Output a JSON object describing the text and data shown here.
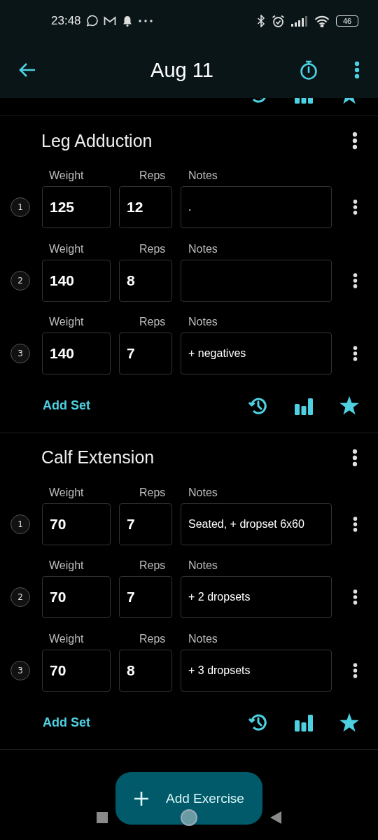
{
  "status_bar": {
    "time": "23:48",
    "battery": "46"
  },
  "header": {
    "title": "Aug 11"
  },
  "exercises": [
    {
      "name": "Leg Adduction",
      "add_set": "Add Set",
      "sets": [
        {
          "number": "1",
          "weight_label": "Weight",
          "reps_label": "Reps",
          "notes_label": "Notes",
          "weight": "125",
          "reps": "12",
          "notes": "."
        },
        {
          "number": "2",
          "weight_label": "Weight",
          "reps_label": "Reps",
          "notes_label": "Notes",
          "weight": "140",
          "reps": "8"
        },
        {
          "number": "3",
          "weight_label": "Weight",
          "reps_label": "Reps",
          "notes_label": "Notes",
          "weight": "140",
          "reps": "7",
          "notes": "+ negatives"
        }
      ]
    },
    {
      "name": "Calf Extension",
      "add_set": "Add Set",
      "sets": [
        {
          "number": "1",
          "weight_label": "Weight",
          "reps_label": "Reps",
          "notes_label": "Notes",
          "weight": "70",
          "reps": "7",
          "notes": "Seated, + dropset 6x60"
        },
        {
          "number": "2",
          "weight_label": "Weight",
          "reps_label": "Reps",
          "notes_label": "Notes",
          "weight": "70",
          "reps": "7",
          "notes": "+ 2 dropsets"
        },
        {
          "number": "3",
          "weight_label": "Weight",
          "reps_label": "Reps",
          "notes_label": "Notes",
          "weight": "70",
          "reps": "8",
          "notes": "+ 3 dropsets"
        }
      ]
    }
  ],
  "fab": {
    "label": "Add Exercise"
  }
}
